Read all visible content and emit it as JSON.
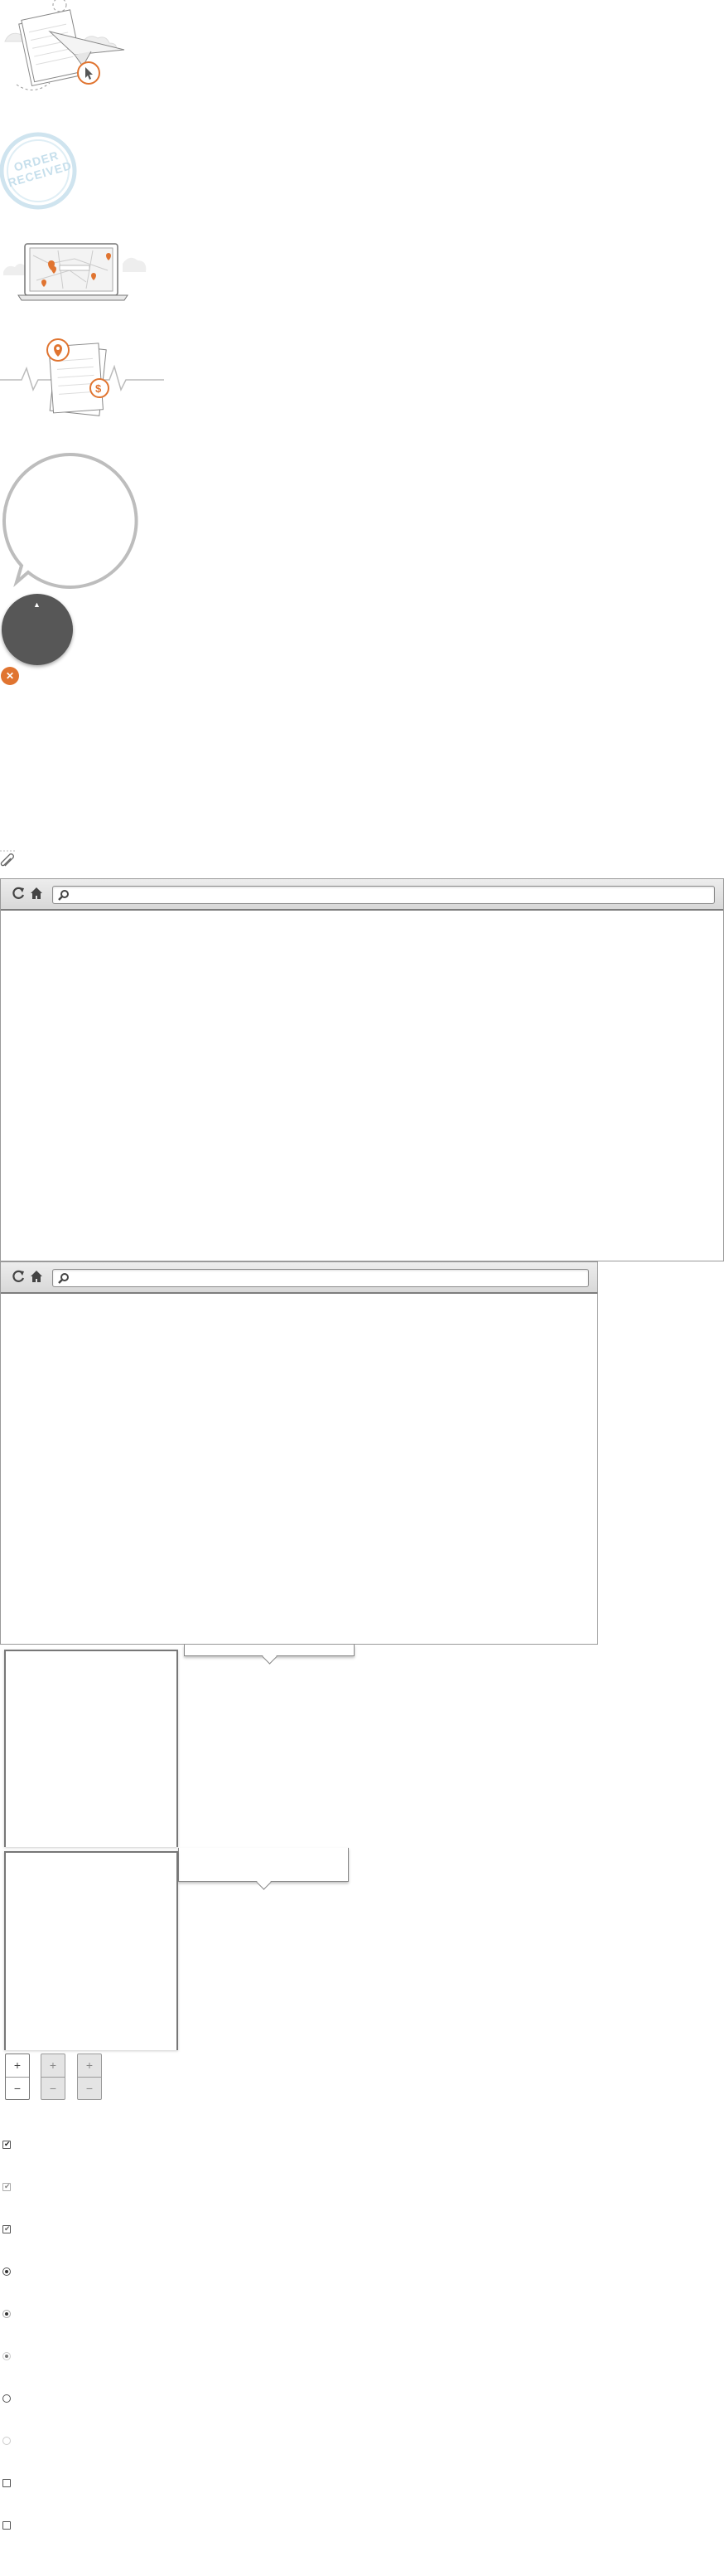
{
  "illustrations": {
    "paper_plane": {
      "icon": "paper-plane-cursor-illustration"
    },
    "order_stamp": {
      "line1": "ORDER",
      "line2": "RECEIVED"
    },
    "laptop_map": {
      "icon": "laptop-map-illustration"
    },
    "documents": {
      "icon": "documents-pin-dollar-illustration",
      "pin_symbol": "•",
      "dollar_symbol": "$"
    }
  },
  "speech_bubble": {
    "icon": "speech-bubble"
  },
  "dark_circle": {
    "arrow": "▲"
  },
  "close_button": {
    "label": "✕",
    "accent": "#e07430"
  },
  "paperclip": {
    "icon": "paperclip-icon"
  },
  "browser_windows": [
    {
      "name": "browser-window-large"
    },
    {
      "name": "browser-window-medium"
    }
  ],
  "steppers": [
    {
      "plus": "+",
      "minus": "−",
      "state": "enabled"
    },
    {
      "plus": "+",
      "minus": "−",
      "state": "disabled"
    },
    {
      "plus": "+",
      "minus": "−",
      "state": "disabled"
    }
  ],
  "controls": [
    {
      "type": "checkbox",
      "checked": true,
      "mark": "✔",
      "tone": "dark"
    },
    {
      "type": "checkbox",
      "checked": true,
      "mark": "✔",
      "tone": "light"
    },
    {
      "type": "checkbox",
      "checked": true,
      "mark": "✔",
      "tone": "light"
    },
    {
      "type": "radio",
      "checked": true,
      "tone": "dark"
    },
    {
      "type": "radio",
      "checked": true,
      "tone": "light"
    },
    {
      "type": "radio",
      "checked": true,
      "tone": "lighter"
    },
    {
      "type": "radio",
      "checked": false,
      "tone": "dark"
    },
    {
      "type": "radio",
      "checked": false,
      "tone": "lighter"
    },
    {
      "type": "checkbox",
      "checked": false,
      "tone": "dark"
    },
    {
      "type": "checkbox",
      "checked": false,
      "tone": "dark"
    }
  ],
  "colors": {
    "accent": "#e07430",
    "stamp": "#b9d9ea",
    "chrome": "#dcdcdc"
  }
}
